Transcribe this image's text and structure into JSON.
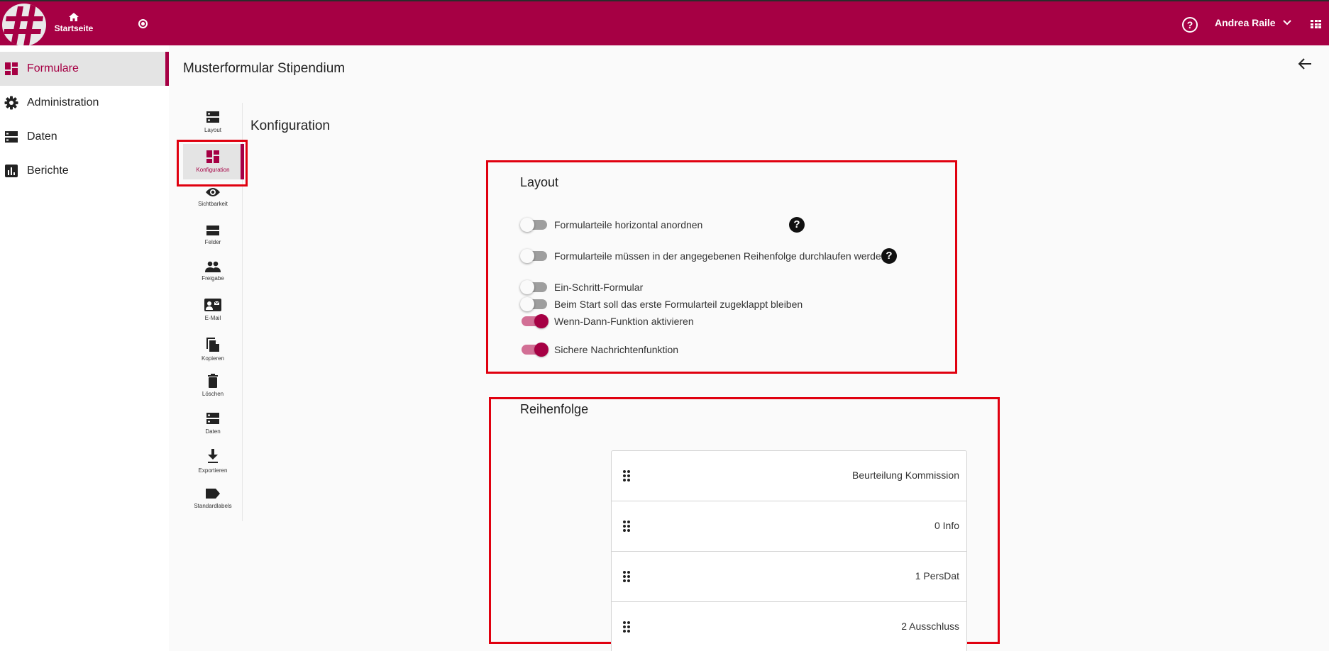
{
  "header": {
    "home_label": "Startseite",
    "user_name": "Andrea Raile",
    "brand_color": "#a60044",
    "icons": [
      "logo-hash",
      "home-icon",
      "radio-icon",
      "help-icon",
      "chevron-down-icon",
      "apps-grid-icon"
    ]
  },
  "sidebar": {
    "items": [
      {
        "label": "Formulare",
        "icon": "dashboard-icon",
        "active": true
      },
      {
        "label": "Administration",
        "icon": "gear-icon",
        "active": false
      },
      {
        "label": "Daten",
        "icon": "storage-icon",
        "active": false
      },
      {
        "label": "Berichte",
        "icon": "bar-chart-icon",
        "active": false
      }
    ]
  },
  "page": {
    "title": "Musterformular Stipendium",
    "section_title": "Konfiguration"
  },
  "subnav": {
    "items": [
      {
        "label": "Layout",
        "icon": "storage-icon"
      },
      {
        "label": "Konfiguration",
        "icon": "dashboard-icon",
        "active": true
      },
      {
        "label": "Sichtbarkeit",
        "icon": "eye-icon"
      },
      {
        "label": "Felder",
        "icon": "view-agenda-icon"
      },
      {
        "label": "Freigabe",
        "icon": "people-icon"
      },
      {
        "label": "E-Mail",
        "icon": "contact-mail-icon"
      },
      {
        "label": "Kopieren",
        "icon": "copy-icon"
      },
      {
        "label": "Löschen",
        "icon": "trash-icon"
      },
      {
        "label": "Daten",
        "icon": "storage-icon"
      },
      {
        "label": "Exportieren",
        "icon": "download-icon"
      },
      {
        "label": "Standardlabels",
        "icon": "label-icon"
      }
    ]
  },
  "layout_card": {
    "title": "Layout",
    "toggles": [
      {
        "label": "Formularteile horizontal anordnen",
        "on": false,
        "help": true
      },
      {
        "label": "Formularteile müssen in der angegebenen Reihenfolge durchlaufen werden",
        "on": false,
        "help": true
      },
      {
        "label": "Ein-Schritt-Formular",
        "on": false,
        "help": false
      },
      {
        "label": "Beim Start soll das erste Formularteil zugeklappt bleiben",
        "on": false,
        "help": false
      },
      {
        "label": "Wenn-Dann-Funktion aktivieren",
        "on": true,
        "help": false
      },
      {
        "label": "Sichere Nachrichtenfunktion",
        "on": true,
        "help": false
      }
    ],
    "help_glyph": "?"
  },
  "order_card": {
    "title": "Reihenfolge",
    "items": [
      "Beurteilung Kommission",
      "0 Info",
      "1 PersDat",
      "2 Ausschluss"
    ]
  }
}
